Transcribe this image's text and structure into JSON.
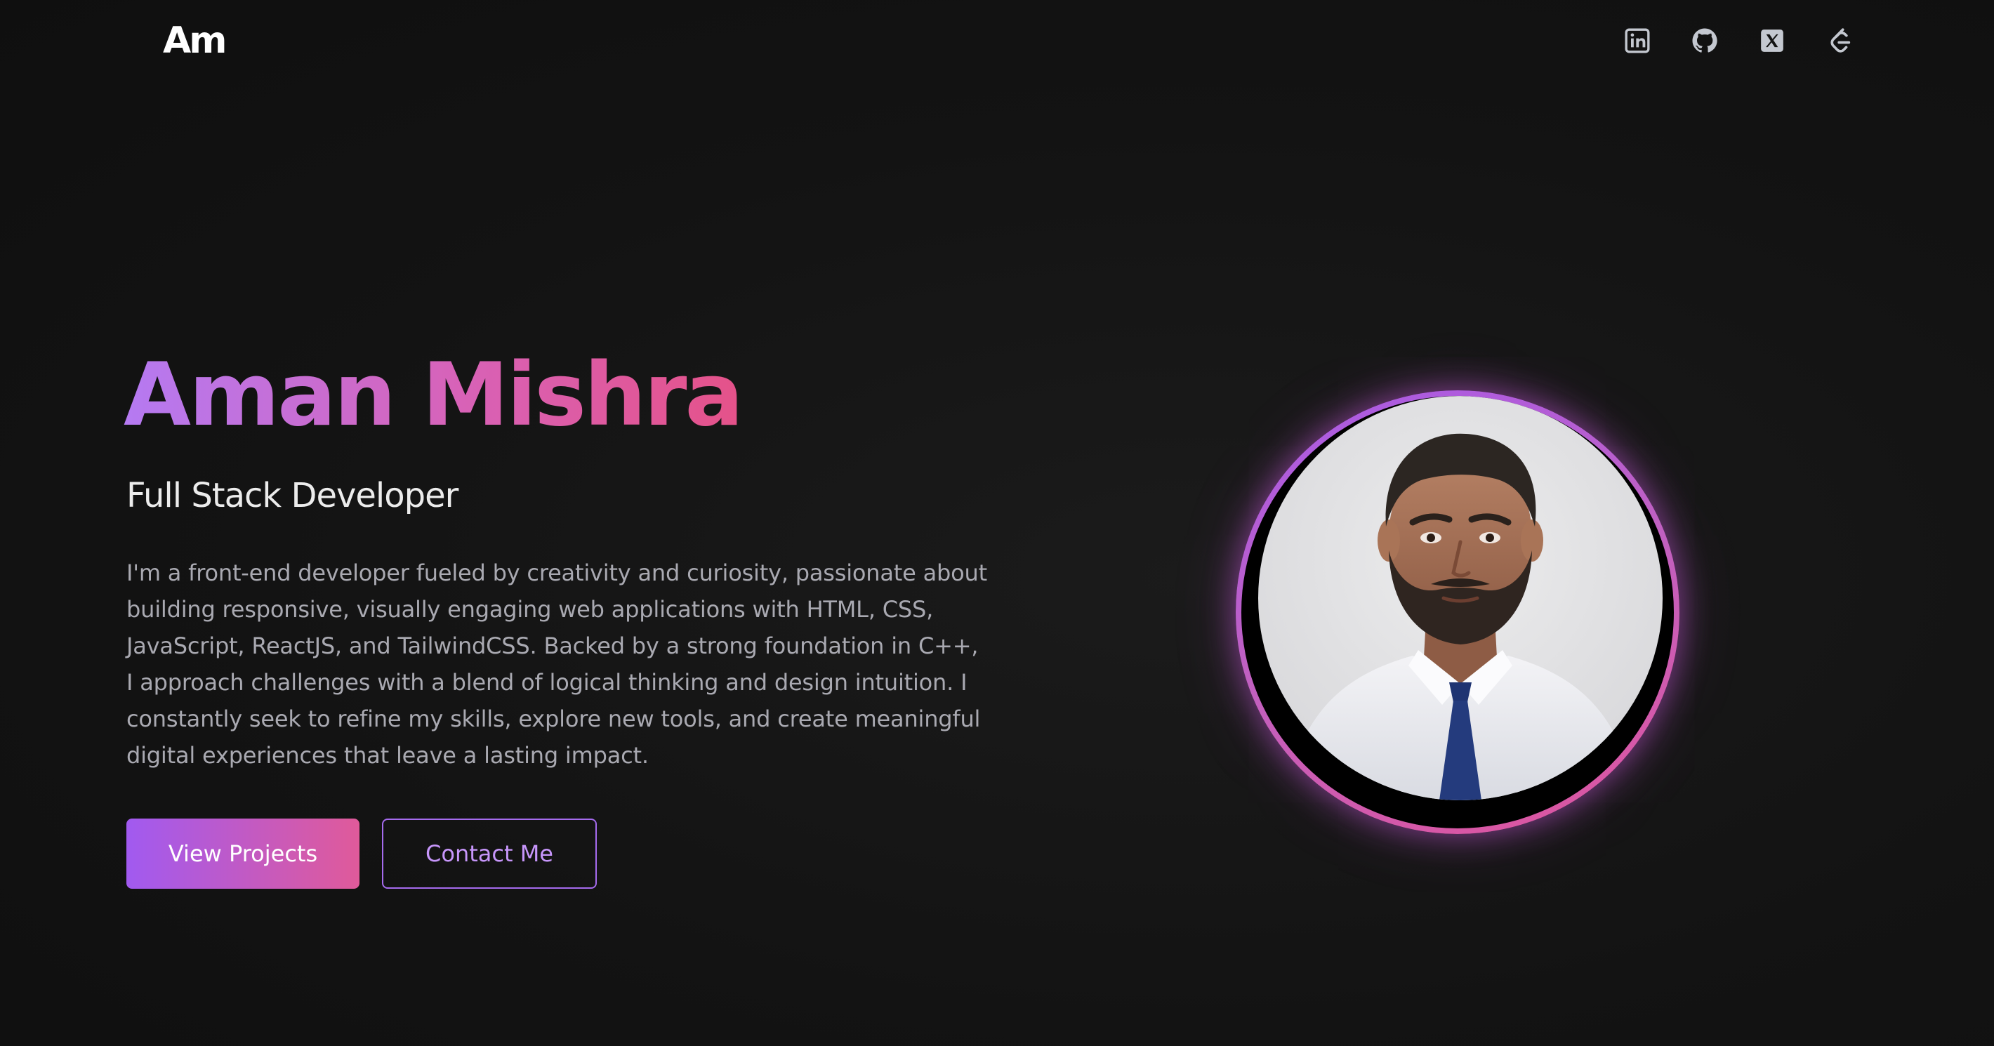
{
  "header": {
    "logo_text": "Am",
    "social_links": [
      {
        "name": "linkedin",
        "icon": "linkedin-icon"
      },
      {
        "name": "github",
        "icon": "github-icon"
      },
      {
        "name": "x",
        "icon": "x-icon"
      },
      {
        "name": "leetcode",
        "icon": "leetcode-icon"
      }
    ]
  },
  "hero": {
    "name": "Aman Mishra",
    "role": "Full Stack Developer",
    "bio": "I'm a front-end developer fueled by creativity and curiosity, passionate about building responsive, visually engaging web applications with HTML, CSS, JavaScript, ReactJS, and TailwindCSS. Backed by a strong foundation in C++, I approach challenges with a blend of logical thinking and design intuition. I constantly seek to refine my skills, explore new tools, and create meaningful digital experiences that leave a lasting impact.",
    "primary_button": "View Projects",
    "secondary_button": "Contact Me"
  },
  "colors": {
    "background": "#131313",
    "gradient_start": "#a15af0",
    "gradient_end": "#e05a9a",
    "icon": "#c4c8d0",
    "text_muted": "#a9a9b1"
  }
}
